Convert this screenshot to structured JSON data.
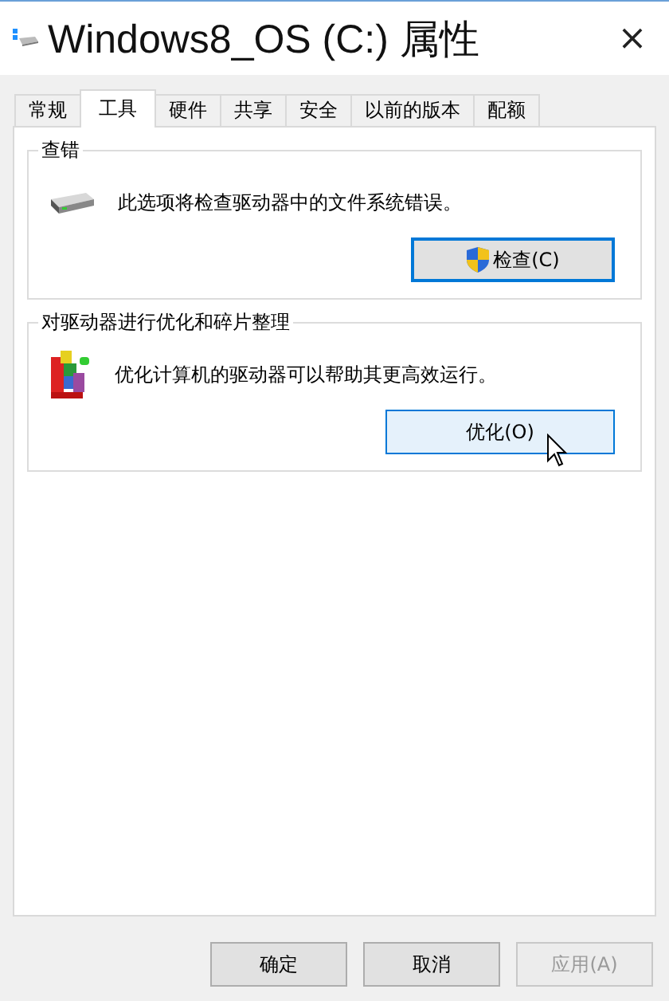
{
  "window": {
    "title": "Windows8_OS (C:) 属性",
    "close": "×"
  },
  "tabs": [
    {
      "label": "常规",
      "selected": false
    },
    {
      "label": "工具",
      "selected": true
    },
    {
      "label": "硬件",
      "selected": false
    },
    {
      "label": "共享",
      "selected": false
    },
    {
      "label": "安全",
      "selected": false
    },
    {
      "label": "以前的版本",
      "selected": false
    },
    {
      "label": "配额",
      "selected": false
    }
  ],
  "groups": [
    {
      "title": "查错",
      "kind": "drive",
      "text": "此选项将检查驱动器中的文件系统错误。",
      "button": {
        "label": "检查(C)",
        "shield": true,
        "focused": true,
        "hovered": false
      }
    },
    {
      "title": "对驱动器进行优化和碎片整理",
      "kind": "defrag",
      "text": "优化计算机的驱动器可以帮助其更高效运行。",
      "button": {
        "label": "优化(O)",
        "shield": false,
        "focused": false,
        "hovered": true
      }
    }
  ],
  "buttons": [
    {
      "label": "确定",
      "disabled": false
    },
    {
      "label": "取消",
      "disabled": false
    },
    {
      "label": "应用(A)",
      "disabled": true
    }
  ]
}
